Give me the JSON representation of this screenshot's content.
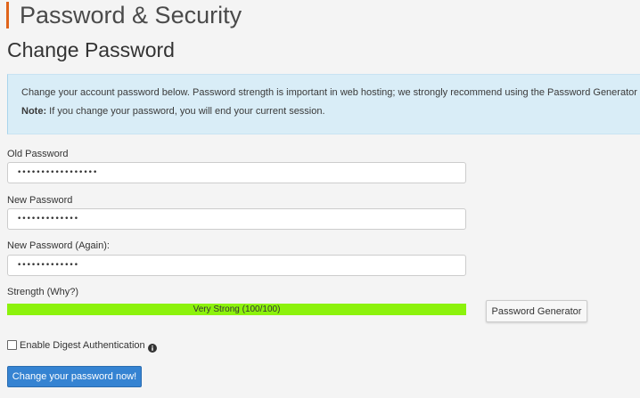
{
  "header": {
    "title": "Password & Security",
    "accent_color": "#e0641b"
  },
  "section": {
    "title": "Change Password"
  },
  "notice": {
    "line1": "Change your account password below. Password strength is important in web hosting; we strongly recommend using the Password Generator to create your password.",
    "note_label": "Note:",
    "note_text": " If you change your password, you will end your current session.",
    "background": "#d9edf7"
  },
  "form": {
    "old_password": {
      "label": "Old Password",
      "value": "•••••••••••••••••"
    },
    "new_password": {
      "label": "New Password",
      "value": "•••••••••••••"
    },
    "new_password_again": {
      "label": "New Password (Again):",
      "value": "•••••••••••••"
    },
    "strength": {
      "label": "Strength (Why?)",
      "text": "Very Strong (100/100)",
      "score": 100,
      "max": 100,
      "color": "#8cf20c"
    },
    "generator_button": "Password Generator",
    "digest": {
      "label": "Enable Digest Authentication",
      "checked": false,
      "icon": "info-circle-icon"
    },
    "submit_button": "Change your password now!",
    "submit_color": "#3583d2"
  }
}
